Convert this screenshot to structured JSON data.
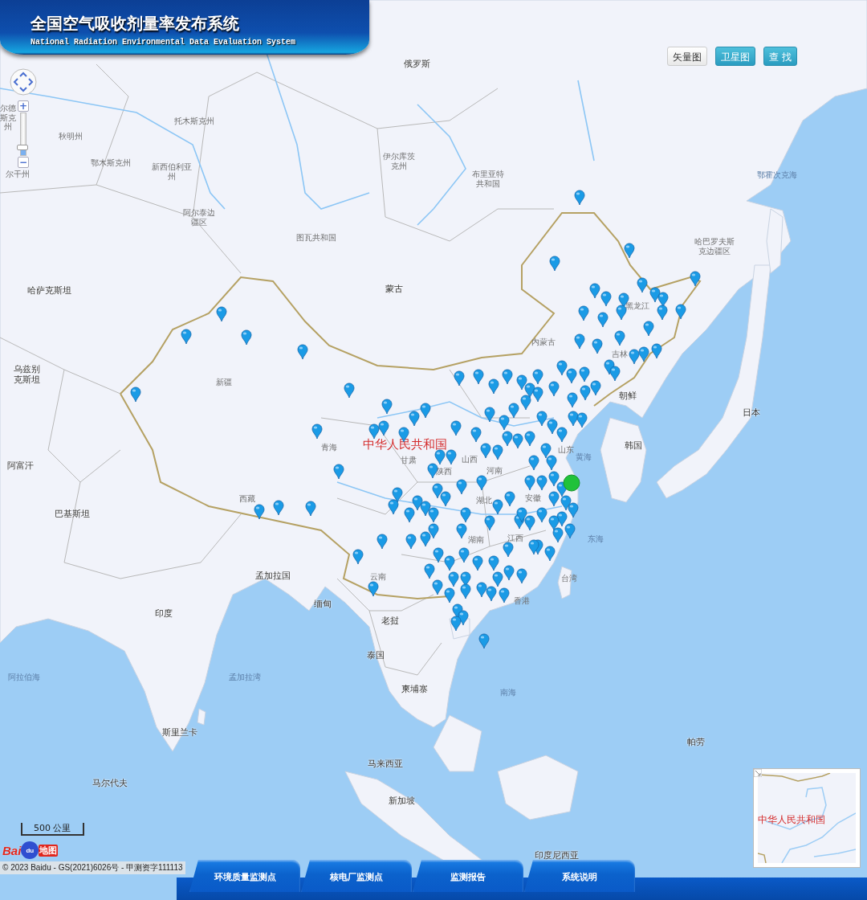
{
  "header": {
    "title": "全国空气吸收剂量率发布系统",
    "subtitle": "National Radiation Environmental Data Evaluation System"
  },
  "map_buttons": [
    {
      "label": "矢量图",
      "kind": "plain"
    },
    {
      "label": "卫星图",
      "kind": "accent"
    },
    {
      "label": "查 找",
      "kind": "accent"
    }
  ],
  "zoom": {
    "zoom_in": "+",
    "zoom_out": "−",
    "level": 0.12
  },
  "map_labels": [
    {
      "text": "俄罗斯",
      "kind": "country"
    },
    {
      "text": "托木斯克州",
      "kind": "region"
    },
    {
      "text": "秋明州",
      "kind": "region"
    },
    {
      "text": "鄂木斯克州",
      "kind": "region"
    },
    {
      "text": "新西伯利亚州",
      "kind": "region"
    },
    {
      "text": "尔德斯克州",
      "kind": "region"
    },
    {
      "text": "尔干州",
      "kind": "region"
    },
    {
      "text": "伊尔库茨克州",
      "kind": "region"
    },
    {
      "text": "布里亚特共和国",
      "kind": "region"
    },
    {
      "text": "阿尔泰边疆区",
      "kind": "region"
    },
    {
      "text": "图瓦共和国",
      "kind": "region"
    },
    {
      "text": "哈萨克斯坦",
      "kind": "country"
    },
    {
      "text": "蒙古",
      "kind": "country"
    },
    {
      "text": "哈巴罗夫斯克边疆区",
      "kind": "region"
    },
    {
      "text": "鄂霍次克海",
      "kind": "sea"
    },
    {
      "text": "黑龙江",
      "kind": "region"
    },
    {
      "text": "内蒙古",
      "kind": "region"
    },
    {
      "text": "吉林",
      "kind": "region"
    },
    {
      "text": "新疆",
      "kind": "region"
    },
    {
      "text": "乌兹别克斯坦",
      "kind": "country"
    },
    {
      "text": "朝鲜",
      "kind": "country"
    },
    {
      "text": "日本",
      "kind": "country"
    },
    {
      "text": "青海",
      "kind": "region"
    },
    {
      "text": "中华人民共和国",
      "kind": "home"
    },
    {
      "text": "甘肃",
      "kind": "region"
    },
    {
      "text": "山西",
      "kind": "region"
    },
    {
      "text": "山东",
      "kind": "region"
    },
    {
      "text": "陕西",
      "kind": "region"
    },
    {
      "text": "河南",
      "kind": "region"
    },
    {
      "text": "韩国",
      "kind": "country"
    },
    {
      "text": "黄海",
      "kind": "sea"
    },
    {
      "text": "阿富汗",
      "kind": "country"
    },
    {
      "text": "西藏",
      "kind": "region"
    },
    {
      "text": "湖北",
      "kind": "region"
    },
    {
      "text": "安徽",
      "kind": "region"
    },
    {
      "text": "巴基斯坦",
      "kind": "country"
    },
    {
      "text": "湖南",
      "kind": "region"
    },
    {
      "text": "江西",
      "kind": "region"
    },
    {
      "text": "东海",
      "kind": "sea"
    },
    {
      "text": "云南",
      "kind": "region"
    },
    {
      "text": "台湾",
      "kind": "region"
    },
    {
      "text": "香港",
      "kind": "region"
    },
    {
      "text": "孟加拉国",
      "kind": "country"
    },
    {
      "text": "缅甸",
      "kind": "country"
    },
    {
      "text": "印度",
      "kind": "country"
    },
    {
      "text": "老挝",
      "kind": "country"
    },
    {
      "text": "泰国",
      "kind": "country"
    },
    {
      "text": "阿拉伯海",
      "kind": "sea"
    },
    {
      "text": "孟加拉湾",
      "kind": "sea"
    },
    {
      "text": "柬埔寨",
      "kind": "country"
    },
    {
      "text": "南海",
      "kind": "sea"
    },
    {
      "text": "斯里兰卡",
      "kind": "country"
    },
    {
      "text": "帕劳",
      "kind": "country"
    },
    {
      "text": "马来西亚",
      "kind": "country"
    },
    {
      "text": "马尔代夫",
      "kind": "country"
    },
    {
      "text": "新加坡",
      "kind": "country"
    },
    {
      "text": "印度尼西亚",
      "kind": "country"
    }
  ],
  "highlighted_station": {
    "selected": true
  },
  "scale": {
    "label": "500 公里"
  },
  "logo": {
    "brand": "Bai",
    "paw": "du",
    "product": "地图"
  },
  "copyright": "© 2023 Baidu - GS(2021)6026号 - 甲测资字111113",
  "overview_map": {
    "label": "中华人民共和国"
  },
  "bottom_tabs": [
    {
      "label": "环境质量监测点"
    },
    {
      "label": "核电厂监测点"
    },
    {
      "label": "监测报告"
    },
    {
      "label": "系统说明"
    }
  ]
}
